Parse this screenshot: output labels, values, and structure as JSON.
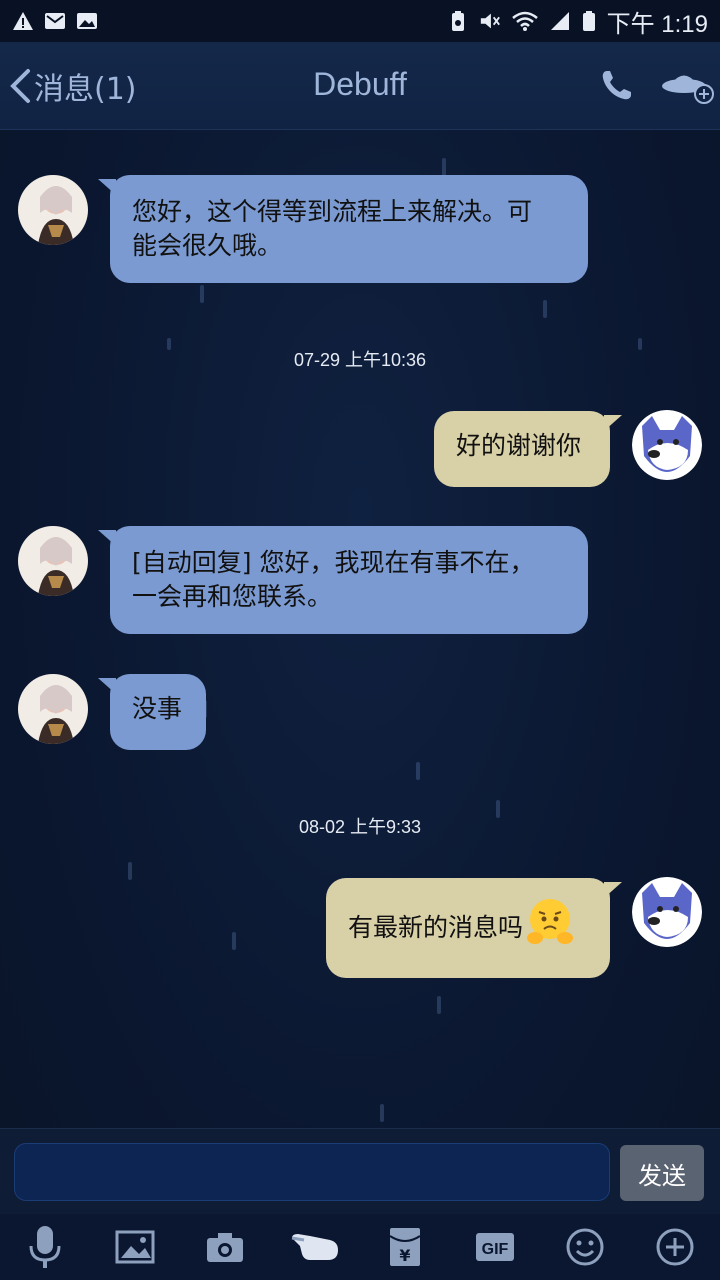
{
  "status_bar": {
    "time": "下午 1:19",
    "left_icons": [
      "warning-icon",
      "mail-icon",
      "image-icon"
    ],
    "right_icons": [
      "battery-saver-icon",
      "mute-icon",
      "wifi-icon",
      "signal-icon",
      "battery-icon"
    ]
  },
  "header": {
    "back_label": "消息(1)",
    "title": "Debuff",
    "actions": [
      "phone-icon",
      "ufo-add-icon"
    ]
  },
  "messages": [
    {
      "side": "left",
      "text_line1": "您好，这个得等到流程上来解决。可",
      "text_line2": "能会很久哦。"
    },
    {
      "type": "timestamp",
      "text": "07-29 上午10:36"
    },
    {
      "side": "right",
      "text": "好的谢谢你"
    },
    {
      "side": "left",
      "text_line1": "[自动回复] 您好，我现在有事不在，",
      "text_line2": "一会再和您联系。"
    },
    {
      "side": "left",
      "text": "没事"
    },
    {
      "type": "timestamp",
      "text": "08-02 上午9:33"
    },
    {
      "side": "right",
      "text": "有最新的消息吗",
      "emoji": "worried-face-emoji"
    }
  ],
  "composer": {
    "placeholder": "",
    "send_label": "发送"
  },
  "toolbar": {
    "items": [
      "microphone-icon",
      "picture-icon",
      "camera-icon",
      "poke-hand-icon",
      "red-packet-icon",
      "gif-icon",
      "emoji-icon",
      "plus-icon"
    ],
    "gif_label": "GIF",
    "redpacket_label": "¥"
  },
  "colors": {
    "background": "#0b1730",
    "left_bubble": "#7b9ad1",
    "right_bubble": "#d8d0a7",
    "header_text": "#9fb6da"
  }
}
